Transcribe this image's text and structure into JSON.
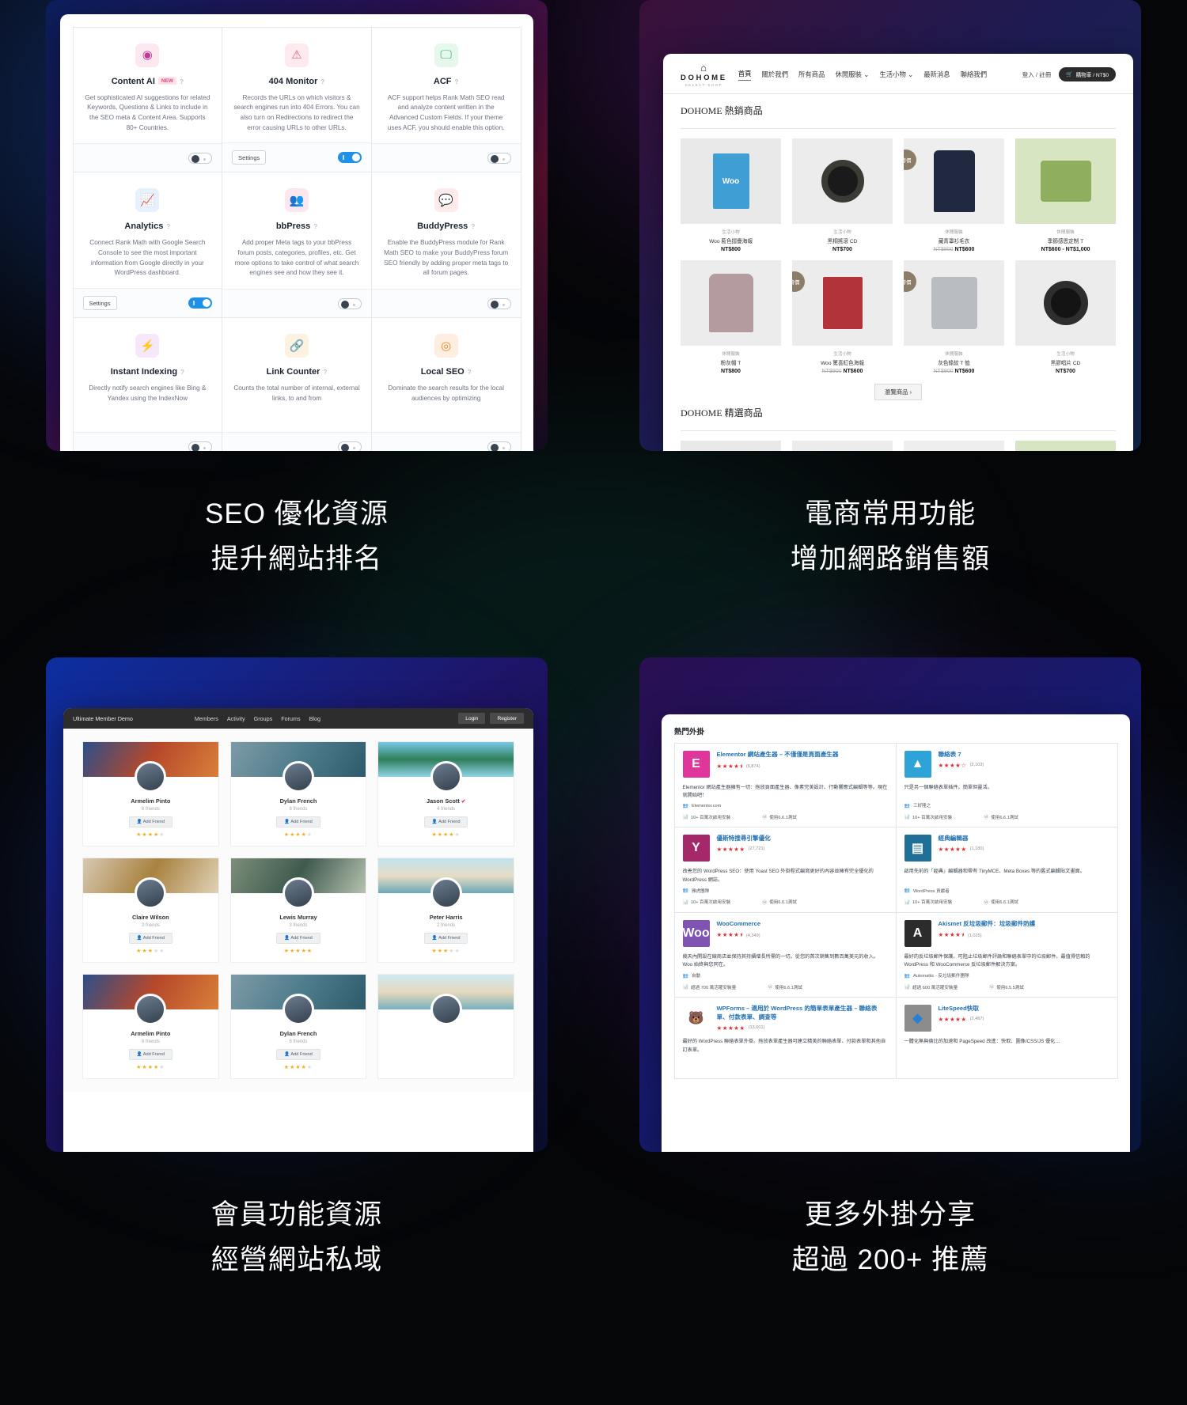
{
  "features": [
    {
      "id": "seo",
      "caption_line1": "SEO 優化資源",
      "caption_line2": "提升網站排名"
    },
    {
      "id": "ecommerce",
      "caption_line1": "電商常用功能",
      "caption_line2": "增加網路銷售額"
    },
    {
      "id": "membership",
      "caption_line1": "會員功能資源",
      "caption_line2": "經營網站私域"
    },
    {
      "id": "plugins",
      "caption_line1": "更多外掛分享",
      "caption_line2": "超過 200+ 推薦"
    }
  ],
  "rankmath": {
    "modules": [
      {
        "title": "Content AI",
        "badge": "NEW",
        "icon": "content-ai-icon",
        "icon_glyph": "◉",
        "icon_bg": "#fde8f1",
        "icon_color": "#c0379a",
        "desc": "Get sophisticated AI suggestions for related Keywords, Questions & Links to include in the SEO meta & Content Area. Supports 80+ Countries.",
        "has_settings": false,
        "toggle": "off"
      },
      {
        "title": "404 Monitor",
        "badge": "",
        "icon": "warning-triangle-icon",
        "icon_glyph": "⚠",
        "icon_bg": "#fdeaee",
        "icon_color": "#e8607f",
        "desc": "Records the URLs on which visitors & search engines run into 404 Errors. You can also turn on Redirections to redirect the error causing URLs to other URLs.",
        "has_settings": true,
        "settings_label": "Settings",
        "toggle": "on"
      },
      {
        "title": "ACF",
        "badge": "",
        "icon": "monitor-icon",
        "icon_glyph": "🖵",
        "icon_bg": "#e6f7ec",
        "icon_color": "#3aab6a",
        "desc": "ACF support helps Rank Math SEO read and analyze content written in the Advanced Custom Fields. If your theme uses ACF, you should enable this option.",
        "has_settings": false,
        "toggle": "off"
      },
      {
        "title": "Analytics",
        "badge": "",
        "icon": "analytics-chart-icon",
        "icon_glyph": "📈",
        "icon_bg": "#e7f0fd",
        "icon_color": "#3b82f6",
        "desc": "Connect Rank Math with Google Search Console to see the most important information from Google directly in your WordPress dashboard.",
        "has_settings": true,
        "settings_label": "Settings",
        "toggle": "on"
      },
      {
        "title": "bbPress",
        "badge": "",
        "icon": "people-group-icon",
        "icon_glyph": "👥",
        "icon_bg": "#fde7ef",
        "icon_color": "#e8457c",
        "desc": "Add proper Meta tags to your bbPress forum posts, categories, profiles, etc. Get more options to take control of what search engines see and how they see it.",
        "has_settings": false,
        "toggle": "off"
      },
      {
        "title": "BuddyPress",
        "badge": "",
        "icon": "chat-bubble-icon",
        "icon_glyph": "💬",
        "icon_bg": "#fdeaea",
        "icon_color": "#e05757",
        "desc": "Enable the BuddyPress module for Rank Math SEO to make your BuddyPress forum SEO friendly by adding proper meta tags to all forum pages.",
        "has_settings": false,
        "toggle": "off"
      },
      {
        "title": "Instant Indexing",
        "badge": "",
        "icon": "lightning-bolt-icon",
        "icon_glyph": "⚡",
        "icon_bg": "#f6e7fb",
        "icon_color": "#9333c2",
        "desc": "Directly notify search engines like Bing & Yandex using the IndexNow",
        "has_settings": false,
        "toggle": "off"
      },
      {
        "title": "Link Counter",
        "badge": "",
        "icon": "link-chain-icon",
        "icon_glyph": "🔗",
        "icon_bg": "#fdf2e0",
        "icon_color": "#e0a23a",
        "desc": "Counts the total number of internal, external links, to and from",
        "has_settings": false,
        "toggle": "off"
      },
      {
        "title": "Local SEO",
        "badge": "",
        "icon": "map-pin-icon",
        "icon_glyph": "◎",
        "icon_bg": "#fdeee0",
        "icon_color": "#ec8b28",
        "desc": "Dominate the search results for the local audiences by optimizing",
        "has_settings": false,
        "toggle": "off"
      }
    ]
  },
  "dohome": {
    "logo_name": "DOHOME",
    "logo_sub": "SELECT SHOP",
    "nav": [
      {
        "label": "首頁",
        "active": true,
        "caret": false
      },
      {
        "label": "關於我們",
        "active": false,
        "caret": false
      },
      {
        "label": "所有商品",
        "active": false,
        "caret": false
      },
      {
        "label": "休閒服裝",
        "active": false,
        "caret": true
      },
      {
        "label": "生活小物",
        "active": false,
        "caret": true
      },
      {
        "label": "最新消息",
        "active": false,
        "caret": false
      },
      {
        "label": "聯絡我們",
        "active": false,
        "caret": false
      }
    ],
    "account_link": "登入 / 註冊",
    "cart_label": "購物車 / NT$0",
    "section_title": "DOHOME 熱銷商品",
    "section_title_2": "DOHOME 精選商品",
    "browse_button": "瀏覽商品 ›",
    "sale_badge": "特價",
    "products_row1": [
      {
        "cat": "生活小物",
        "name": "Woo 藍色摺疊海報",
        "price": "NT$800",
        "old": "",
        "badge": false,
        "img": "woo-poster"
      },
      {
        "cat": "生活小物",
        "name": "黑桐搖滾 CD",
        "price": "NT$700",
        "old": "",
        "badge": false,
        "img": "vinyl-record"
      },
      {
        "cat": "休閒服裝",
        "name": "藏青罩衫毛衣",
        "price": "NT$600",
        "old": "NT$800",
        "badge": true,
        "img": "navy-sweater"
      },
      {
        "cat": "休閒服裝",
        "name": "季節感恩定制 T",
        "price": "NT$600 - NT$1,000",
        "old": "",
        "badge": false,
        "img": "green-tee"
      }
    ],
    "products_row2": [
      {
        "cat": "休閒服裝",
        "name": "粉灰帽 T",
        "price": "NT$800",
        "old": "",
        "badge": false,
        "img": "pink-hoodie"
      },
      {
        "cat": "生活小物",
        "name": "Woo 驚喜紅色海報",
        "price": "NT$600",
        "old": "NT$900",
        "badge": true,
        "img": "red-poster"
      },
      {
        "cat": "休閒服裝",
        "name": "灰色條紋 T 恤",
        "price": "NT$600",
        "old": "NT$900",
        "badge": true,
        "img": "grey-tee"
      },
      {
        "cat": "生活小物",
        "name": "黑膠唱片 CD",
        "price": "NT$700",
        "old": "",
        "badge": false,
        "img": "vinyl-record-2"
      }
    ]
  },
  "ultimate_member": {
    "brand": "Ultimate Member Demo",
    "nav": [
      "Members",
      "Activity",
      "Groups",
      "Forums",
      "Blog"
    ],
    "login_label": "Login",
    "register_label": "Register",
    "add_friend_label": "Add Friend",
    "members": [
      {
        "name": "Armelim Pinto",
        "friends": "8 friends",
        "stars": 4,
        "cover": "city",
        "verified": false
      },
      {
        "name": "Dylan French",
        "friends": "8 friends",
        "stars": 4,
        "cover": "fjord",
        "verified": false
      },
      {
        "name": "Jason Scott",
        "friends": "4 friends",
        "stars": 4,
        "cover": "island",
        "verified": true
      },
      {
        "name": "Claire Wilson",
        "friends": "3 friends",
        "stars": 3,
        "cover": "flower",
        "verified": false
      },
      {
        "name": "Lewis Murray",
        "friends": "3 friends",
        "stars": 5,
        "cover": "lake",
        "verified": false
      },
      {
        "name": "Peter Harris",
        "friends": "2 friends",
        "stars": 3,
        "cover": "beach",
        "verified": false
      },
      {
        "name": "Armelim Pinto",
        "friends": "8 friends",
        "stars": 4,
        "cover": "city",
        "verified": false
      },
      {
        "name": "Dylan French",
        "friends": "8 friends",
        "stars": 4,
        "cover": "fjord",
        "verified": false
      },
      {
        "name": "",
        "friends": "",
        "stars": 0,
        "cover": "beach2",
        "verified": false
      }
    ]
  },
  "plugins": {
    "title": "熱門外掛",
    "active_label_10m": "10+ 百萬次啟用安裝",
    "items": [
      {
        "name": "Elementor 網站產生器 – 不僅僅是頁面產生器",
        "stars": "★★★★⯨",
        "count": "(6,874)",
        "desc": "Elementor 網站產生器擁有一切：拖放頁面產生器、像素完美設計、行動響應式編輯等等。現在就開始吧！",
        "author": "Elementor.com",
        "installs": "10+ 百萬次啟用安裝",
        "tested": "使用6.6.1測試",
        "icon": "elementor-icon",
        "icon_glyph": "E",
        "icon_bg": "#e0359a",
        "icon_color": "#ffffff"
      },
      {
        "name": "聯絡表 7",
        "stars": "★★★★☆",
        "count": "(2,103)",
        "desc": "只是另一個聯絡表單插件。簡單但靈活。",
        "author": "三好隆之",
        "installs": "10+ 百萬次啟用安裝",
        "tested": "使用6.6.1測試",
        "icon": "contact-form-7-icon",
        "icon_glyph": "▲",
        "icon_bg": "#2ea3d8",
        "icon_color": "#ffffff"
      },
      {
        "name": "優斯特搜尋引擎優化",
        "stars": "★★★★★",
        "count": "(27,721)",
        "desc": "改善您的 WordPress SEO：使用 Yoast SEO 外掛程式編寫更好的內容並擁有完全優化的 WordPress 網誌。",
        "author": "雅虎團隊",
        "installs": "10+ 百萬次啟用安裝",
        "tested": "使用6.6.1測試",
        "icon": "yoast-seo-icon",
        "icon_glyph": "Y",
        "icon_bg": "#a4286a",
        "icon_color": "#ffffff"
      },
      {
        "name": "經典編輯器",
        "stars": "★★★★★",
        "count": "(1,180)",
        "desc": "啟用先前的「經典」編輯器和帶有 TinyMCE、Meta Boxes 等的舊式編輯貼文畫面。",
        "author": "WordPress 貢獻者",
        "installs": "10+ 百萬次啟用安裝",
        "tested": "使用6.6.1測試",
        "icon": "classic-editor-icon",
        "icon_glyph": "▤",
        "icon_bg": "#1f6f96",
        "icon_color": "#ffffff"
      },
      {
        "name": "WooCommerce",
        "stars": "★★★★⯨",
        "count": "(4,349)",
        "desc": "幾天內開設在線商店並保持其持續增長所需的一切。從您的首次銷售到數百萬美元的收入。Woo 始終與您同在。",
        "author": "自動",
        "installs": "超過 700 萬活躍安裝量",
        "tested": "使用6.6.1測試",
        "icon": "woocommerce-icon",
        "icon_glyph": "Woo",
        "icon_bg": "#7f54b3",
        "icon_color": "#ffffff"
      },
      {
        "name": "Akismet 反垃圾郵件：垃圾郵件防護",
        "stars": "★★★★⯨",
        "count": "(1,025)",
        "desc": "最好的反垃圾郵件保護。可阻止垃圾郵件評論和聯絡表單中的垃圾郵件。最值得信賴的 WordPress 和 WooCommerce 反垃圾郵件解決方案。",
        "author": "Automattic - 反垃圾郵件團隊",
        "installs": "超過 600 萬活躍安裝量",
        "tested": "使用6.5.5測試",
        "icon": "akismet-icon",
        "icon_glyph": "A",
        "icon_bg": "#2c2c2c",
        "icon_color": "#ffffff"
      },
      {
        "name": "WPForms – 適用於 WordPress 的簡單表單產生器 – 聯絡表單、付款表單、調查等",
        "stars": "★★★★★",
        "count": "(13,601)",
        "desc": "最好的 WordPress 聯絡表單外掛。拖放表單產生器可建立精美的聯絡表單、付款表單和其他自訂表單。",
        "author": "",
        "installs": "",
        "tested": "",
        "icon": "wpforms-icon",
        "icon_glyph": "🐻",
        "icon_bg": "#ffffff",
        "icon_color": "#e27730"
      },
      {
        "name": "LiteSpeed快取",
        "stars": "★★★★★",
        "count": "(2,487)",
        "desc": "一體化無與倫比的加速和 PageSpeed 改進：快取、圖像/CSS/JS 優化…",
        "author": "",
        "installs": "",
        "tested": "",
        "icon": "litespeed-icon",
        "icon_glyph": "◆",
        "icon_bg": "#8c8c8c",
        "icon_color": "#2a7fd4"
      }
    ]
  }
}
